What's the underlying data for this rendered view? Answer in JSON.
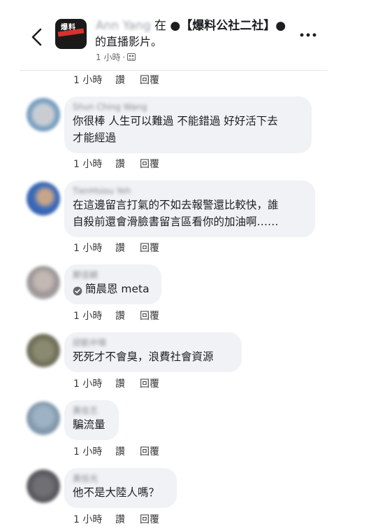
{
  "header": {
    "poster_name": "Ann Yang",
    "connector": "在",
    "page_name": "●【爆料公社二社】●",
    "line2": "的直播影片。",
    "time": "1 小時",
    "separator": "·",
    "avatar_text": "爆料"
  },
  "actions": {
    "like_label": "讚",
    "reply_label": "回覆"
  },
  "top_action": {
    "time": "1 小時"
  },
  "comments": [
    {
      "name": "Shun Ching Wang",
      "lines": [
        "你很棒 人生可以難過 不能錯過 好好活下去",
        "才能經過"
      ],
      "time": "1 小時"
    },
    {
      "name": "TienHsiou Yeh",
      "lines": [
        "在這邊留言打氣的不如去報警還比較快，誰",
        "自殺前還會滑臉書留言區看你的加油啊……"
      ],
      "time": "1 小時"
    },
    {
      "name": "鄭佳穎",
      "mention": "簡晨恩 meta",
      "time": "1 小時"
    },
    {
      "name": "邱凱中瑋",
      "lines": [
        "死死才不會臭，浪費社會資源"
      ],
      "time": "1 小時"
    },
    {
      "name": "黃信丕",
      "lines": [
        "騙流量"
      ],
      "time": "1 小時"
    },
    {
      "name": "黃信光",
      "lines": [
        "他不是大陸人嗎？"
      ],
      "time": "1 小時"
    }
  ],
  "colors": {
    "bubble": "#f0f2f5",
    "meta_text": "#65676b",
    "brand_red": "#d8322d"
  },
  "icons": {
    "back": "chevron-left-icon",
    "more": "more-dots-icon",
    "privacy": "friends-privacy-icon",
    "mention": "verified-mention-icon"
  }
}
